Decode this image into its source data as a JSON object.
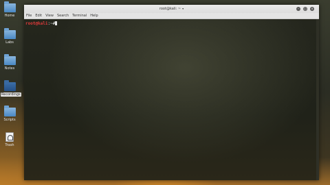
{
  "desktop": {
    "icons": [
      {
        "label": "Home"
      },
      {
        "label": "Labs"
      },
      {
        "label": "Notes"
      },
      {
        "label": "Recordings"
      },
      {
        "label": "Scripts"
      },
      {
        "label": "Trash"
      }
    ]
  },
  "window": {
    "title": "root@kali: ~",
    "menu": [
      "File",
      "Edit",
      "View",
      "Search",
      "Terminal",
      "Help"
    ]
  },
  "terminal": {
    "user_host": "root@kali",
    "separator": ":",
    "path": "~#"
  }
}
